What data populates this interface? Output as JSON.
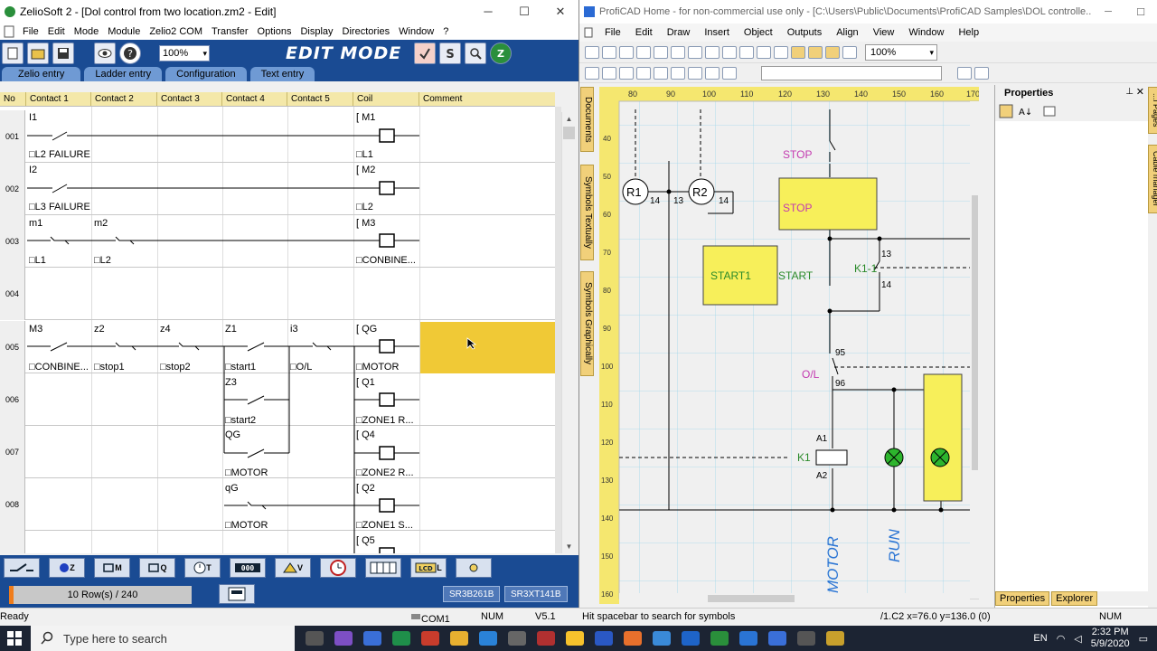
{
  "zelio": {
    "title": "ZelioSoft 2 - [Dol control from two location.zm2 - Edit]",
    "menu": [
      "File",
      "Edit",
      "Mode",
      "Module",
      "Zelio2 COM",
      "Transfer",
      "Options",
      "Display",
      "Directories",
      "Window",
      "?"
    ],
    "zoom": "100%",
    "mode_banner": "EDIT MODE",
    "tabs": [
      "Zelio entry",
      "Ladder entry",
      "Configuration",
      "Text entry"
    ],
    "columns": [
      "No",
      "Contact 1",
      "Contact 2",
      "Contact 3",
      "Contact 4",
      "Contact 5",
      "Coil",
      "Comment"
    ],
    "rows": [
      "001",
      "002",
      "003",
      "004",
      "005",
      "006",
      "007",
      "008"
    ],
    "labels": {
      "r1_c1_top": "I1",
      "r1_c1_bot": "L2 FAILURE",
      "r1_coil_top": "M1",
      "r1_coil_bot": "L1",
      "r2_c1_top": "I2",
      "r2_c1_bot": "L3 FAILURE",
      "r2_coil_top": "M2",
      "r2_coil_bot": "L2",
      "r3_c1_top": "m1",
      "r3_c2_top": "m2",
      "r3_c1_bot": "L1",
      "r3_c2_bot": "L2",
      "r3_coil_top": "M3",
      "r3_coil_bot": "CONBINE...",
      "r5_c1_top": "M3",
      "r5_c2_top": "z2",
      "r5_c3_top": "z4",
      "r5_c4_top": "Z1",
      "r5_c5_top": "i3",
      "r5_coil_top": "QG",
      "r5_c1_bot": "CONBINE...",
      "r5_c2_bot": "stop1",
      "r5_c3_bot": "stop2",
      "r5_c4_bot": "start1",
      "r5_c5_bot": "O/L",
      "r5_coil_bot": "MOTOR",
      "r6_c4_top": "Z3",
      "r6_c4_bot": "start2",
      "r6_coil_top": "Q1",
      "r6_coil_bot": "ZONE1 R...",
      "r7_c4_top": "QG",
      "r7_c4_bot": "MOTOR",
      "r7_coil_top": "Q4",
      "r7_coil_bot": "ZONE2 R...",
      "r8_c4_top": "qG",
      "r8_c4_bot": "MOTOR",
      "r8_coil_top": "Q2",
      "r8_coil_bot": "ZONE1 S...",
      "r9_coil_top": "Q5"
    },
    "rows_count": "10 Row(s) / 240",
    "models": [
      "SR3B261B",
      "SR3XT141B"
    ],
    "tool_labels": [
      "Z",
      "M",
      "Q",
      "T",
      "V",
      "L"
    ],
    "status": {
      "left": "Ready",
      "com": "COM1",
      "num": "NUM",
      "ver": "V5.1"
    }
  },
  "proficad": {
    "title": "ProfiCAD Home - for non-commercial use only - [C:\\Users\\Public\\Documents\\ProfiCAD Samples\\DOL controlle...",
    "menu": [
      "File",
      "Edit",
      "Draw",
      "Insert",
      "Object",
      "Outputs",
      "Align",
      "View",
      "Window",
      "Help"
    ],
    "zoom": "100%",
    "side_tabs": [
      "Documents",
      "Symbols Textually",
      "Symbols Graphically"
    ],
    "right_tabs": [
      "...l Pages",
      "Cable manager"
    ],
    "ruler_top": [
      "80",
      "90",
      "100",
      "110",
      "120",
      "130",
      "140",
      "150",
      "160",
      "170"
    ],
    "ruler_left": [
      "40",
      "50",
      "60",
      "70",
      "80",
      "90",
      "100",
      "110",
      "120",
      "130",
      "140",
      "150",
      "160"
    ],
    "schematic": {
      "stop1": "STOP",
      "stop2": "STOP",
      "start1": "START1",
      "start": "START",
      "k11": "K1-1",
      "n13a": "13",
      "n14a": "14",
      "r1": "R1",
      "r2": "R2",
      "n14b": "14",
      "n13b": "13",
      "n14c": "14",
      "n95": "95",
      "n96": "96",
      "ol": "O/L",
      "a1": "A1",
      "a2": "A2",
      "k1": "K1",
      "motor": "MOTOR",
      "run": "RUN"
    },
    "properties_title": "Properties",
    "props_tabs": [
      "Properties",
      "Explorer"
    ],
    "status": {
      "left": "Hit spacebar to search for symbols",
      "coords": "/1.C2  x=76.0  y=136.0 (0)",
      "num": "NUM"
    }
  },
  "taskbar": {
    "search": "Type here to search",
    "lang": "EN",
    "time": "2:32 PM",
    "date": "5/9/2020"
  }
}
